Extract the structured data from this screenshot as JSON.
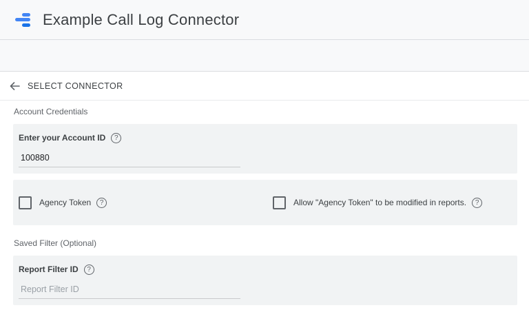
{
  "header": {
    "app_title": "Example Call Log Connector",
    "logo_icon": "looker-studio-logo-icon"
  },
  "nav": {
    "back_icon": "arrow-left-icon",
    "back_label": "SELECT CONNECTOR"
  },
  "account_section": {
    "title": "Account Credentials",
    "account_id": {
      "label": "Enter your Account ID",
      "help_icon": "help-circle-icon",
      "value": "100880"
    },
    "agency_token": {
      "label": "Agency Token",
      "checked": false,
      "help_icon": "help-circle-icon"
    },
    "allow_modify": {
      "label": "Allow \"Agency Token\" to be modified in reports.",
      "checked": false,
      "help_icon": "help-circle-icon"
    }
  },
  "filter_section": {
    "title": "Saved Filter (Optional)",
    "report_filter_id": {
      "label": "Report Filter ID",
      "help_icon": "help-circle-icon",
      "value": "",
      "placeholder": "Report Filter ID"
    }
  },
  "colors": {
    "accent_blue": "#4285f4",
    "card_bg": "#f1f3f4",
    "header_bg": "#f8f9fa"
  }
}
